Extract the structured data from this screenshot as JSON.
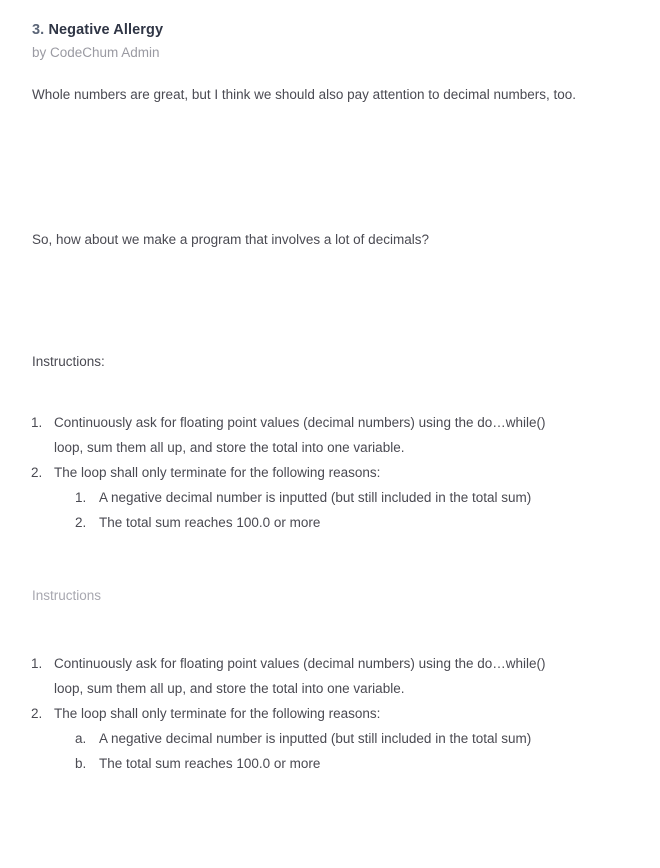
{
  "header": {
    "number": "3.",
    "title": "Negative Allergy",
    "author": "by CodeChum Admin"
  },
  "body": {
    "intro_paragraph": "Whole numbers are great, but I think we should also pay attention to decimal numbers, too.",
    "question_paragraph": "So, how about we make a program that involves a lot of decimals?",
    "instructions_label": "Instructions:",
    "instructions_label_2": "Instructions"
  },
  "instructions_list_1": {
    "items": [
      {
        "text": "Continuously ask for floating point values (decimal numbers) using the do…while() loop, sum them all up, and store the total into one variable.",
        "subitems": []
      },
      {
        "text": "The loop shall only terminate for the following reasons:",
        "subitems": [
          "A negative decimal number is inputted (but still included in the total sum)",
          "The total sum reaches 100.0 or more"
        ]
      }
    ],
    "marker_style": "decimal",
    "sub_marker_style": "decimal"
  },
  "instructions_list_2": {
    "items": [
      {
        "text": "Continuously ask for floating point values (decimal numbers) using the do…while() loop, sum them all up, and store the total into one variable.",
        "subitems": []
      },
      {
        "text": "The loop shall only terminate for the following reasons:",
        "subitems": [
          "A negative decimal number is inputted (but still included in the total sum)",
          "The total sum reaches 100.0 or more"
        ]
      }
    ],
    "marker_style": "decimal",
    "sub_marker_style": "lower-alpha"
  },
  "colors": {
    "background": "#ffffff",
    "title_text": "#2f3545",
    "title_number": "#5c6678",
    "author_text": "#9a9aa2",
    "body_text": "#4a4a52",
    "muted_label": "#a8a8b0"
  }
}
